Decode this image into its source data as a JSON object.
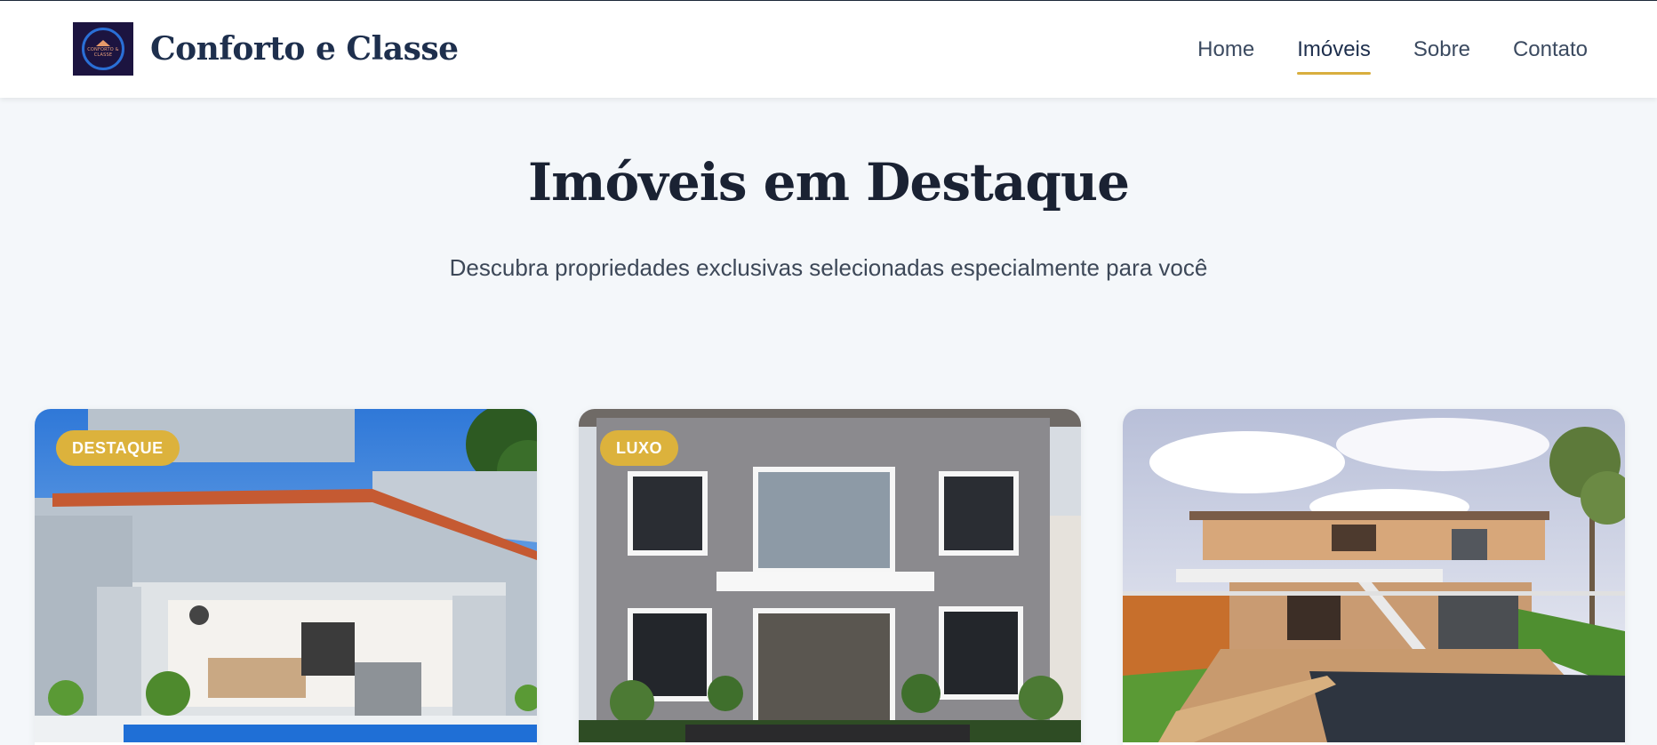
{
  "brand": {
    "name": "Conforto e Classe",
    "logo_text": "CONFORTO & CLASSE"
  },
  "nav": {
    "items": [
      {
        "label": "Home",
        "active": false
      },
      {
        "label": "Imóveis",
        "active": true
      },
      {
        "label": "Sobre",
        "active": false
      },
      {
        "label": "Contato",
        "active": false
      }
    ]
  },
  "hero": {
    "title": "Imóveis em Destaque",
    "subtitle": "Descubra propriedades exclusivas selecionadas especialmente para você"
  },
  "properties": [
    {
      "badge": "DESTAQUE",
      "image": "house-with-pool-photo"
    },
    {
      "badge": "LUXO",
      "image": "gray-two-story-house-photo"
    },
    {
      "badge": "",
      "image": "modern-stone-house-with-pool-photo"
    }
  ],
  "colors": {
    "accent": "#dcb23c",
    "navy": "#1e2f4d",
    "background": "#f4f7fa"
  }
}
